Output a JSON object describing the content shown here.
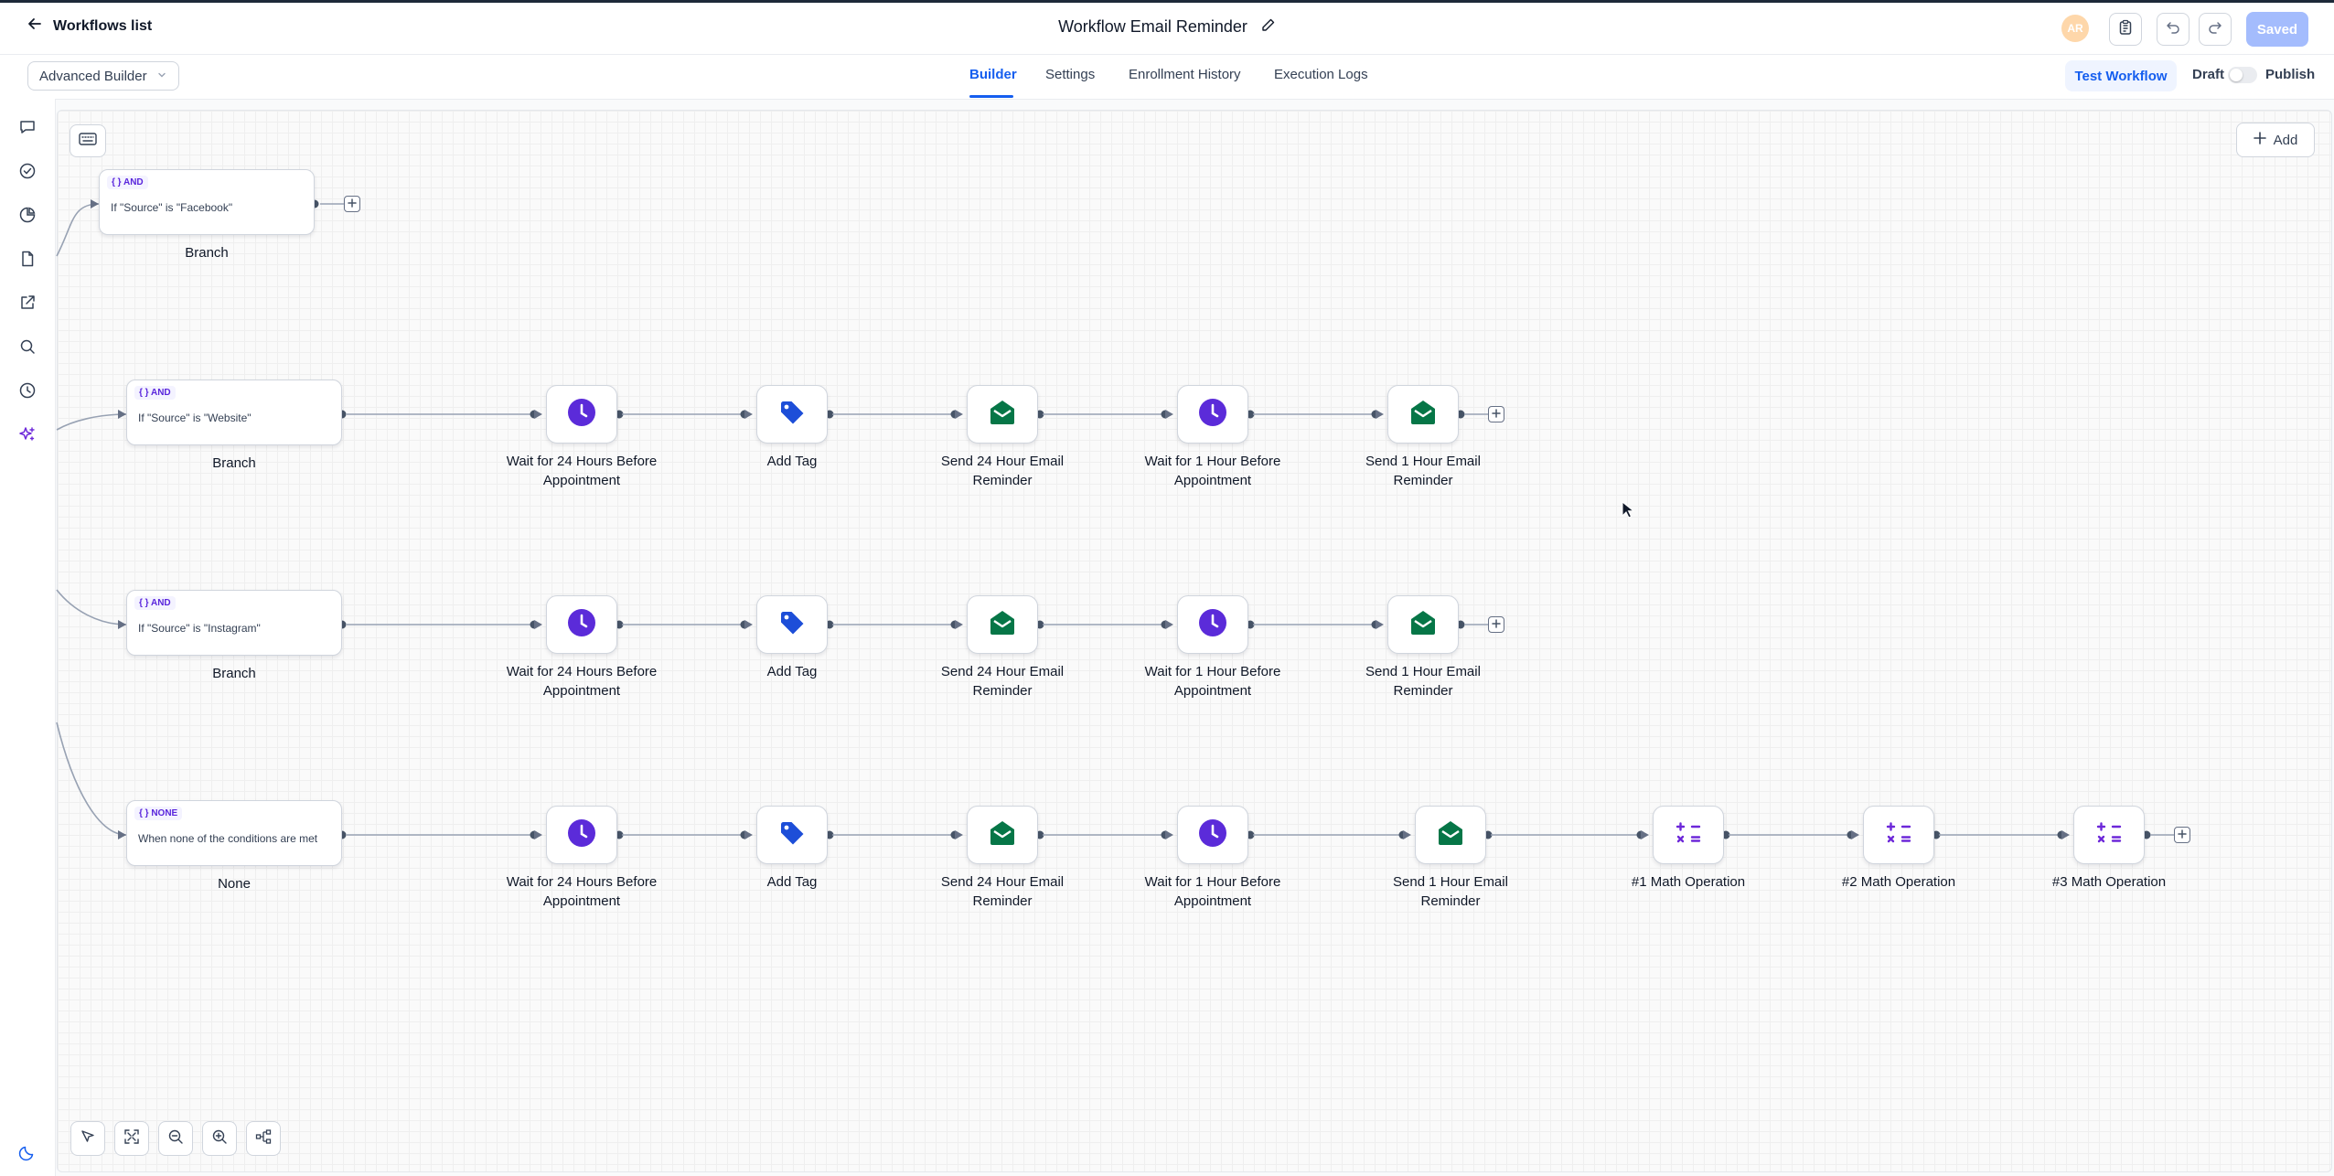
{
  "header": {
    "back_label": "Workflows list",
    "workflow_title": "Workflow Email Reminder",
    "avatar_initials": "AR",
    "saved_label": "Saved"
  },
  "subheader": {
    "builder_mode": "Advanced Builder",
    "tabs": [
      {
        "label": "Builder",
        "active": true
      },
      {
        "label": "Settings",
        "active": false
      },
      {
        "label": "Enrollment History",
        "active": false
      },
      {
        "label": "Execution Logs",
        "active": false
      }
    ],
    "test_button": "Test Workflow",
    "draft_label": "Draft",
    "publish_label": "Publish",
    "publish_toggle_on": false
  },
  "sidebar": {
    "icons": [
      "chat-icon",
      "check-circle-icon",
      "pie-chart-icon",
      "document-icon",
      "external-link-icon",
      "search-icon",
      "history-icon",
      "sparkle-icon"
    ],
    "bottom_icon": "moon-icon"
  },
  "canvas": {
    "add_label": "Add",
    "branches": [
      {
        "chip": "AND",
        "condition": "If \"Source\" is \"Facebook\"",
        "label": "Branch",
        "steps": []
      },
      {
        "chip": "AND",
        "condition": "If \"Source\" is \"Website\"",
        "label": "Branch",
        "steps": [
          {
            "type": "wait",
            "label_line1": "Wait for 24 Hours Before",
            "label_line2": "Appointment"
          },
          {
            "type": "tag",
            "label_line1": "Add Tag",
            "label_line2": ""
          },
          {
            "type": "email",
            "label_line1": "Send 24 Hour Email",
            "label_line2": "Reminder"
          },
          {
            "type": "wait",
            "label_line1": "Wait for 1 Hour Before",
            "label_line2": "Appointment"
          },
          {
            "type": "email",
            "label_line1": "Send 1 Hour Email",
            "label_line2": "Reminder"
          }
        ]
      },
      {
        "chip": "AND",
        "condition": "If \"Source\" is \"Instagram\"",
        "label": "Branch",
        "steps": [
          {
            "type": "wait",
            "label_line1": "Wait for 24 Hours Before",
            "label_line2": "Appointment"
          },
          {
            "type": "tag",
            "label_line1": "Add Tag",
            "label_line2": ""
          },
          {
            "type": "email",
            "label_line1": "Send 24 Hour Email",
            "label_line2": "Reminder"
          },
          {
            "type": "wait",
            "label_line1": "Wait for 1 Hour Before",
            "label_line2": "Appointment"
          },
          {
            "type": "email",
            "label_line1": "Send 1 Hour Email",
            "label_line2": "Reminder"
          }
        ]
      },
      {
        "chip": "NONE",
        "condition": "When none of the conditions are met",
        "label": "None",
        "steps": [
          {
            "type": "wait",
            "label_line1": "Wait for 24 Hours Before",
            "label_line2": "Appointment"
          },
          {
            "type": "tag",
            "label_line1": "Add Tag",
            "label_line2": ""
          },
          {
            "type": "email",
            "label_line1": "Send 24 Hour Email",
            "label_line2": "Reminder"
          },
          {
            "type": "wait",
            "label_line1": "Wait for 1 Hour Before",
            "label_line2": "Appointment"
          },
          {
            "type": "email",
            "label_line1": "Send 1 Hour Email",
            "label_line2": "Reminder"
          },
          {
            "type": "math",
            "label_line1": "#1 Math Operation",
            "label_line2": ""
          },
          {
            "type": "math",
            "label_line1": "#2 Math Operation",
            "label_line2": ""
          },
          {
            "type": "math",
            "label_line1": "#3 Math Operation",
            "label_line2": ""
          }
        ]
      }
    ],
    "zoom_controls": [
      "pointer-icon",
      "fit-view-icon",
      "zoom-out-icon",
      "zoom-in-icon",
      "auto-layout-icon"
    ]
  },
  "colors": {
    "accent": "#155eef",
    "wait_icon": "#5b2bd9",
    "tag_icon": "#1d4ed8",
    "email_icon": "#067647",
    "math_icon": "#6d28d9",
    "saved_button": "#a4bcfd"
  }
}
